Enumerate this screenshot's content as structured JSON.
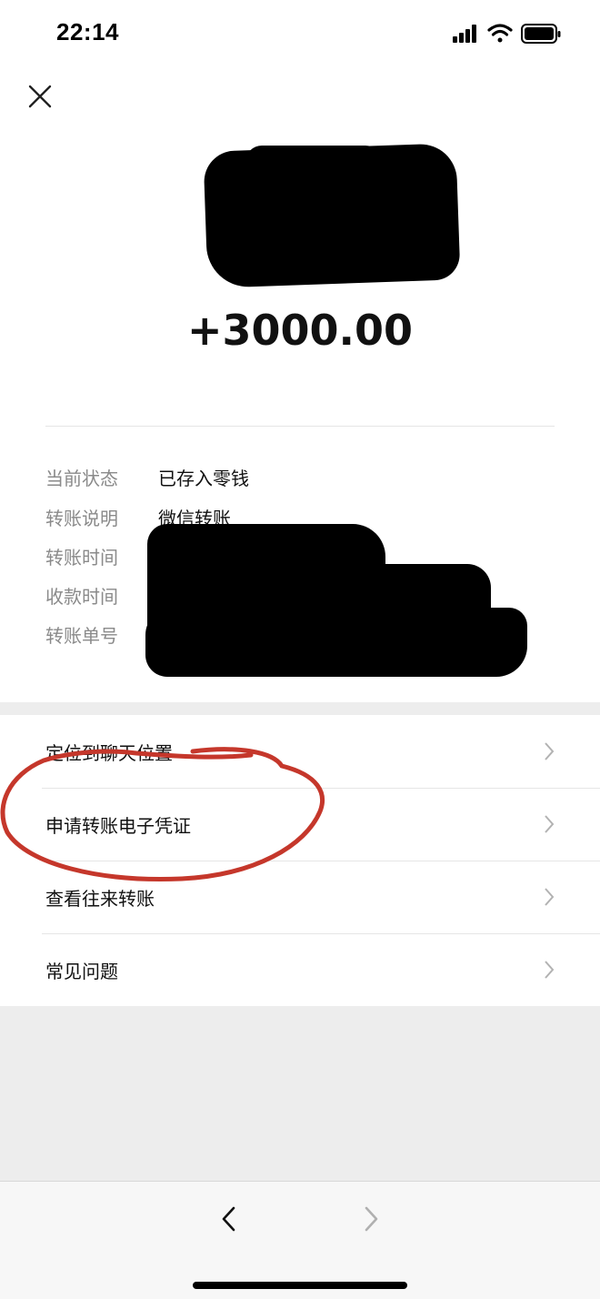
{
  "status_bar": {
    "time": "22:14"
  },
  "transfer": {
    "amount": "+3000.00",
    "details": [
      {
        "key": "当前状态",
        "value": "已存入零钱"
      },
      {
        "key": "转账说明",
        "value": "微信转账"
      },
      {
        "key": "转账时间",
        "value": ""
      },
      {
        "key": "收款时间",
        "value": ""
      },
      {
        "key": "转账单号",
        "value": ""
      }
    ]
  },
  "menu": {
    "items": [
      {
        "label": "定位到聊天位置"
      },
      {
        "label": "申请转账电子凭证"
      },
      {
        "label": "查看往来转账"
      },
      {
        "label": "常见问题"
      }
    ]
  },
  "colors": {
    "annotation_red": "#c5372b",
    "secondary_text": "#8a8a8a",
    "page_background": "#ededed"
  },
  "icons": [
    "close-icon",
    "chevron-right-icon",
    "back-arrow-icon",
    "forward-arrow-icon"
  ]
}
